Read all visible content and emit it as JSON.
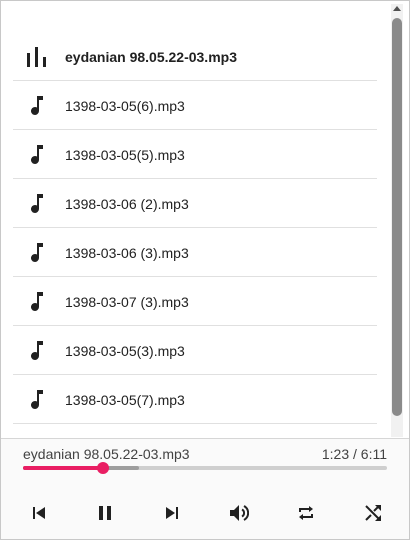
{
  "playlist": {
    "tracks": [
      {
        "name": "eydanian 98.05.22-03.mp3",
        "icon": "equalizer-icon",
        "active": true
      },
      {
        "name": "1398-03-05(6).mp3",
        "icon": "music-note-icon",
        "active": false
      },
      {
        "name": "1398-03-05(5).mp3",
        "icon": "music-note-icon",
        "active": false
      },
      {
        "name": "1398-03-06 (2).mp3",
        "icon": "music-note-icon",
        "active": false
      },
      {
        "name": "1398-03-06 (3).mp3",
        "icon": "music-note-icon",
        "active": false
      },
      {
        "name": "1398-03-07 (3).mp3",
        "icon": "music-note-icon",
        "active": false
      },
      {
        "name": "1398-03-05(3).mp3",
        "icon": "music-note-icon",
        "active": false
      },
      {
        "name": "1398-03-05(7).mp3",
        "icon": "music-note-icon",
        "active": false
      }
    ]
  },
  "player": {
    "now_playing": "eydanian 98.05.22-03.mp3",
    "time": "1:23 / 6:11",
    "progress_fraction": 0.22,
    "buffered_fraction": 0.32,
    "controls": [
      "previous-icon",
      "pause-icon",
      "next-icon",
      "volume-icon",
      "repeat-icon",
      "shuffle-icon"
    ]
  },
  "colors": {
    "accent": "#e91e63",
    "text": "#212121",
    "icon": "#212121"
  }
}
